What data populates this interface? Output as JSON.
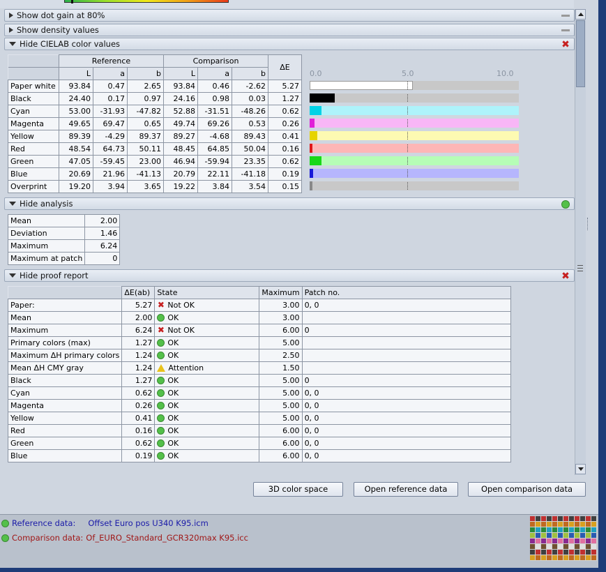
{
  "sections": {
    "dot_gain": "Show dot gain at 80%",
    "density": "Show density values",
    "cielab": "Hide CIELAB color values",
    "analysis": "Hide analysis",
    "proof": "Hide proof report"
  },
  "cielab": {
    "group_ref": "Reference",
    "group_comp": "Comparison",
    "delta_label": "ΔE",
    "col_L": "L",
    "col_a": "a",
    "col_b": "b",
    "scale": [
      "0.0",
      "5.0",
      "10.0"
    ],
    "rows": [
      {
        "name": "Paper white",
        "ref": [
          "93.84",
          "0.47",
          "2.65"
        ],
        "comp": [
          "93.84",
          "0.46",
          "-2.62"
        ],
        "de": "5.27",
        "value": 5.27,
        "color": "#ffffff",
        "track": "#c8c8c8"
      },
      {
        "name": "Black",
        "ref": [
          "24.40",
          "0.17",
          "0.97"
        ],
        "comp": [
          "24.16",
          "0.98",
          "0.03"
        ],
        "de": "1.27",
        "value": 1.27,
        "color": "#000000",
        "track": "#c8c8c8"
      },
      {
        "name": "Cyan",
        "ref": [
          "53.00",
          "-31.93",
          "-47.82"
        ],
        "comp": [
          "52.88",
          "-31.51",
          "-48.26"
        ],
        "de": "0.62",
        "value": 0.62,
        "color": "#00d2e6",
        "track": "#aef3fb"
      },
      {
        "name": "Magenta",
        "ref": [
          "49.65",
          "69.47",
          "0.65"
        ],
        "comp": [
          "49.74",
          "69.26",
          "0.53"
        ],
        "de": "0.26",
        "value": 0.26,
        "color": "#e020d8",
        "track": "#f8b6f6"
      },
      {
        "name": "Yellow",
        "ref": [
          "89.39",
          "-4.29",
          "89.37"
        ],
        "comp": [
          "89.27",
          "-4.68",
          "89.43"
        ],
        "de": "0.41",
        "value": 0.41,
        "color": "#e6d400",
        "track": "#fdfab2"
      },
      {
        "name": "Red",
        "ref": [
          "48.54",
          "64.73",
          "50.11"
        ],
        "comp": [
          "48.45",
          "64.85",
          "50.04"
        ],
        "de": "0.16",
        "value": 0.16,
        "color": "#e01818",
        "track": "#fdb6b6"
      },
      {
        "name": "Green",
        "ref": [
          "47.05",
          "-59.45",
          "23.00"
        ],
        "comp": [
          "46.94",
          "-59.94",
          "23.35"
        ],
        "de": "0.62",
        "value": 0.62,
        "color": "#18d818",
        "track": "#b6fdb6"
      },
      {
        "name": "Blue",
        "ref": [
          "20.69",
          "21.96",
          "-41.13"
        ],
        "comp": [
          "20.79",
          "22.11",
          "-41.18"
        ],
        "de": "0.19",
        "value": 0.19,
        "color": "#1818d8",
        "track": "#b6b6fd"
      },
      {
        "name": "Overprint",
        "ref": [
          "19.20",
          "3.94",
          "3.65"
        ],
        "comp": [
          "19.22",
          "3.84",
          "3.54"
        ],
        "de": "0.15",
        "value": 0.15,
        "color": "#888888",
        "track": "#c8c8c8"
      }
    ]
  },
  "analysis": {
    "rows": [
      {
        "label": "Mean",
        "value": "2.00"
      },
      {
        "label": "Deviation",
        "value": "1.46"
      },
      {
        "label": "Maximum",
        "value": "6.24"
      },
      {
        "label": "Maximum at patch",
        "value": "0"
      }
    ]
  },
  "proof": {
    "headers": [
      "ΔE(ab)",
      "State",
      "Maximum",
      "Patch no."
    ],
    "rows": [
      {
        "label": "Paper:",
        "de": "5.27",
        "state": "Not OK",
        "icon": "x",
        "max": "3.00",
        "patch": "0, 0"
      },
      {
        "label": "Mean",
        "de": "2.00",
        "state": "OK",
        "icon": "ok",
        "max": "3.00",
        "patch": ""
      },
      {
        "label": "Maximum",
        "de": "6.24",
        "state": "Not OK",
        "icon": "x",
        "max": "6.00",
        "patch": "0"
      },
      {
        "label": "Primary colors (max)",
        "de": "1.27",
        "state": "OK",
        "icon": "ok",
        "max": "5.00",
        "patch": ""
      },
      {
        "label": "Maximum ΔH primary colors",
        "de": "1.24",
        "state": "OK",
        "icon": "ok",
        "max": "2.50",
        "patch": ""
      },
      {
        "label": "Mean ΔH CMY gray",
        "de": "1.24",
        "state": "Attention",
        "icon": "warn",
        "max": "1.50",
        "patch": ""
      },
      {
        "label": "Black",
        "de": "1.27",
        "state": "OK",
        "icon": "ok",
        "max": "5.00",
        "patch": "0"
      },
      {
        "label": "Cyan",
        "de": "0.62",
        "state": "OK",
        "icon": "ok",
        "max": "5.00",
        "patch": "0, 0"
      },
      {
        "label": "Magenta",
        "de": "0.26",
        "state": "OK",
        "icon": "ok",
        "max": "5.00",
        "patch": "0, 0"
      },
      {
        "label": "Yellow",
        "de": "0.41",
        "state": "OK",
        "icon": "ok",
        "max": "5.00",
        "patch": "0, 0"
      },
      {
        "label": "Red",
        "de": "0.16",
        "state": "OK",
        "icon": "ok",
        "max": "6.00",
        "patch": "0, 0"
      },
      {
        "label": "Green",
        "de": "0.62",
        "state": "OK",
        "icon": "ok",
        "max": "6.00",
        "patch": "0, 0"
      },
      {
        "label": "Blue",
        "de": "0.19",
        "state": "OK",
        "icon": "ok",
        "max": "6.00",
        "patch": "0, 0"
      }
    ]
  },
  "buttons": {
    "color_space": "3D color space",
    "open_ref": "Open reference data",
    "open_comp": "Open comparison data"
  },
  "footer": {
    "ref_label": "Reference data:",
    "ref_value": "Offset Euro pos U340 K95.icm",
    "comp_label": "Comparison data:",
    "comp_value": "Of_EURO_Standard_GCR320max K95.icc"
  },
  "colors": {
    "ok_green": "#54c04a",
    "error_red": "#c62020",
    "ref_text": "#1a1aa8",
    "comp_text": "#a01818"
  }
}
